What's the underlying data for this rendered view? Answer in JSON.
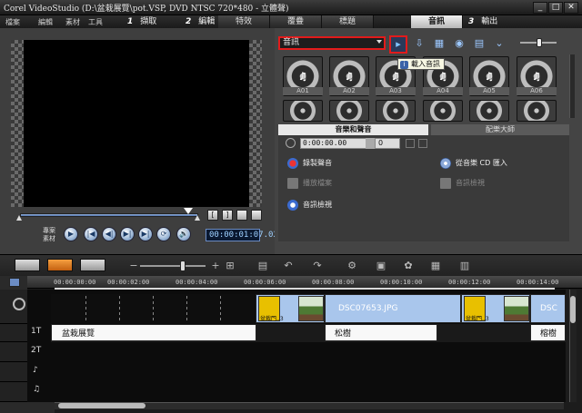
{
  "window": {
    "title": "Corel VideoStudio (D:\\盆栽展覽\\pot.VSP, DVD NTSC 720*480 - 立體聲)",
    "minimize": "_",
    "maximize": "□",
    "close": "✕"
  },
  "menu": {
    "items": [
      "檔案",
      "編輯",
      "素材",
      "工具"
    ]
  },
  "steps": [
    {
      "num": "1",
      "label": "擷取"
    },
    {
      "num": "2",
      "label": "編輯"
    },
    {
      "num": "3",
      "label": "輸出"
    }
  ],
  "tabs": [
    "特效",
    "覆疊",
    "標題",
    "音訊"
  ],
  "active_tab": "音訊",
  "player": {
    "project_label": "專案",
    "clip_label": "素材",
    "timecode": "00:00:01:07.02",
    "mark_in": "[",
    "mark_out": "]",
    "buttons": [
      "▶",
      "|◀",
      "◀|",
      "▶|",
      "▶|",
      "⟳",
      "🔊"
    ]
  },
  "library": {
    "category": "音訊",
    "tooltip": "載入音訊",
    "thumbnails": [
      "A01",
      "A02",
      "A03",
      "A04",
      "A05",
      "A06"
    ]
  },
  "audio_panel": {
    "tab_music": "音樂和聲音",
    "tab_autoscore": "配樂大師",
    "duration": "0:00:00.00",
    "volume": "0",
    "options": [
      {
        "label": "錄製聲音",
        "enabled": true
      },
      {
        "label": "播放檔案",
        "enabled": false
      },
      {
        "label": "音訊檢視",
        "enabled": true
      },
      {
        "label": "從音樂 CD 匯入",
        "enabled": true
      },
      {
        "label": "音訊檢視",
        "enabled": false
      }
    ]
  },
  "timeline": {
    "ruler_ticks": [
      "00:00:00:00",
      "00:00:02:00",
      "00:00:04:00",
      "00:00:06:00",
      "00:00:08:00",
      "00:00:10:00",
      "00:00:12:00",
      "00:00:14:00"
    ],
    "track_labels": [
      "1T",
      "2T",
      "♪",
      "♫"
    ],
    "video_clip_label": "DSC07653.JPG",
    "video_clip_label_2": "DSC",
    "title_clips": [
      "盆栽展覽",
      "松樹",
      "榕樹"
    ],
    "thumb_text": "盆栽門..3"
  },
  "colors": {
    "highlight_red": "#e21b1b",
    "clip_blue": "#a9c6ec",
    "title_white": "#f8f8f8"
  }
}
